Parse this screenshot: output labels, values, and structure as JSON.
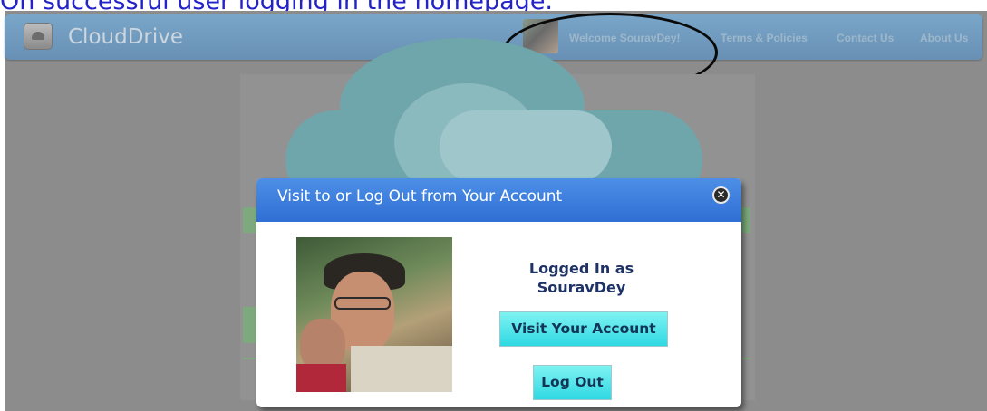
{
  "caption": "On successful user logging in the homepage.",
  "navbar": {
    "brand": "CloudDrive",
    "welcome": "Welcome SouravDey!",
    "links": [
      "Terms & Policies",
      "Contact Us",
      "About Us"
    ]
  },
  "modal": {
    "title": "Visit to or Log Out from Your Account",
    "close_icon": "close-circle-icon",
    "logged_in_line1": "Logged In as",
    "logged_in_user": "SouravDey",
    "visit_button": "Visit Your Account",
    "logout_button": "Log Out"
  },
  "icons": {
    "logo": "clouddrive-logo-icon",
    "avatar": "user-avatar"
  },
  "colors": {
    "caption": "#2323c8",
    "navbar": "#6f98bc",
    "modal_header": "#3b7cdc",
    "button": "#2fd9e3",
    "overlay": "#8c8c8c"
  }
}
